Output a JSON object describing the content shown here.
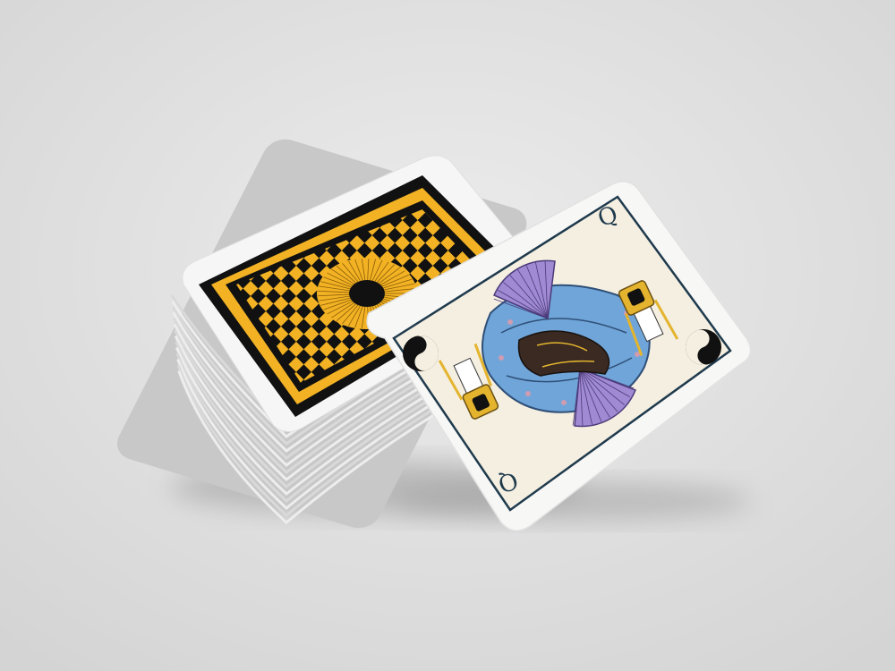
{
  "scene": {
    "background_color": "#dcdcdc",
    "background_highlight": "#ececec",
    "shadow_color": "#9a9a9a"
  },
  "deck": {
    "card_color": "#f6f6f6",
    "back_pattern": "black-and-gold-checkerboard-with-sunburst",
    "gold_color": "#f2b224",
    "black_color": "#111111"
  },
  "face_card": {
    "rank": "Q",
    "suit_icon": "yin-yang-icon",
    "paper_color": "#f4efe1",
    "frame_color": "#1f3a4d",
    "robe_color": "#6fa5d8",
    "fan_color": "#a08ad3",
    "crown_color": "#e4b42e",
    "sash_color": "#3a2a22"
  }
}
